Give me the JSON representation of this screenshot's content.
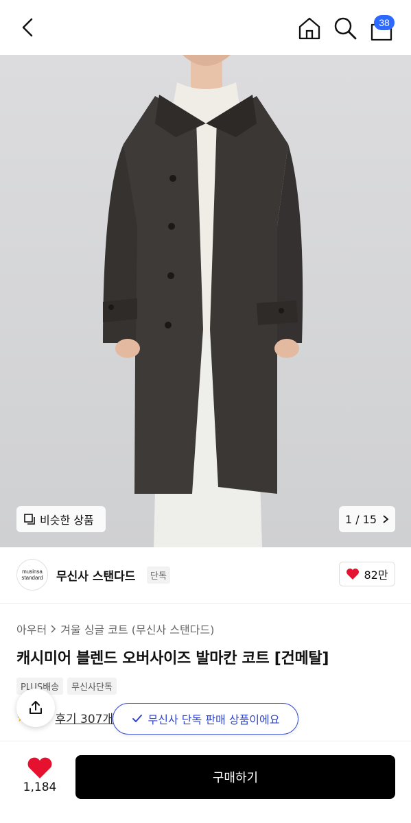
{
  "nav": {
    "cart_count": "38"
  },
  "hero": {
    "similar_label": "비슷한 상품",
    "page_indicator": "1 / 15"
  },
  "brand": {
    "logo_line1": "musinsa",
    "logo_line2": "standard",
    "name": "무신사 스탠다드",
    "tag": "단독",
    "like_count": "82만"
  },
  "product": {
    "breadcrumb": [
      "아우터",
      "겨울 싱글 코트 (무신사 스탠다드)"
    ],
    "title": "캐시미어 블렌드 오버사이즈 발마칸 코트 [건메탈]",
    "tags": [
      "PLUS배송",
      "무신사단독"
    ],
    "review_label": "후기 307개"
  },
  "toast": {
    "exclusive_text": "무신사 단독 판매 상품이에요"
  },
  "bottom": {
    "like_count": "1,184",
    "buy_label": "구매하기"
  },
  "colors": {
    "accent_blue": "#2d68ff",
    "heart_red": "#e5112f",
    "coat": "#3d3a38"
  }
}
